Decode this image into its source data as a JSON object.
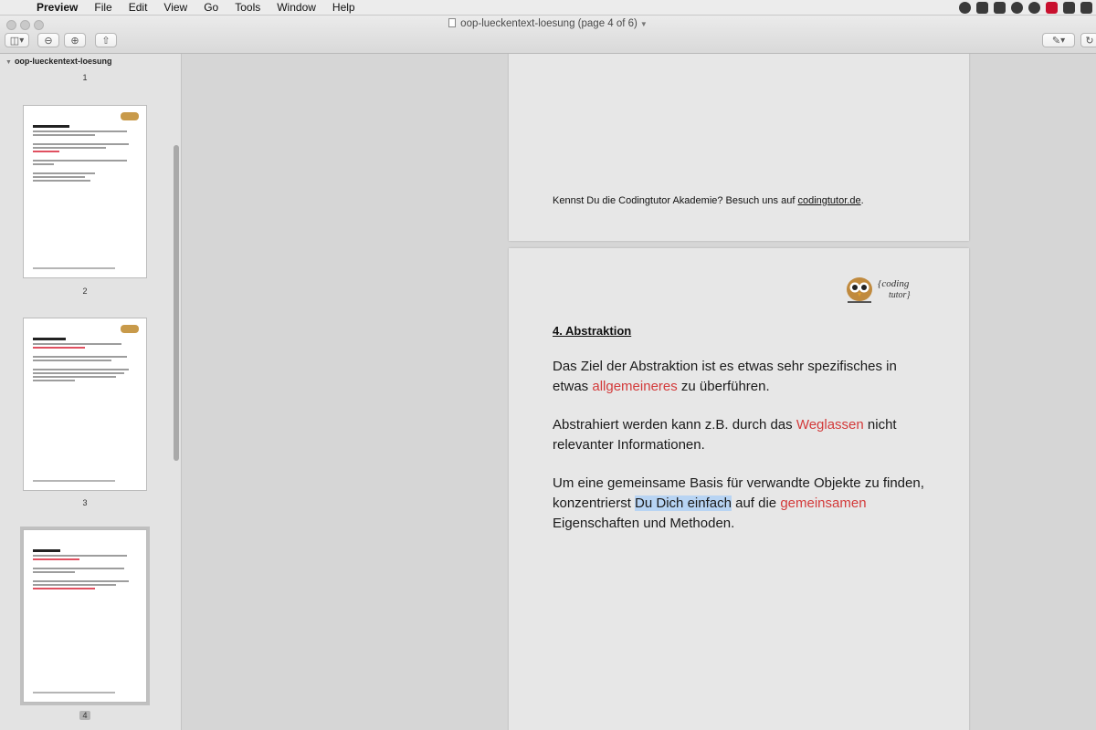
{
  "menubar": {
    "app_name": "Preview",
    "menus": [
      "File",
      "Edit",
      "View",
      "Go",
      "Tools",
      "Window",
      "Help"
    ]
  },
  "window": {
    "title": "oop-lueckentext-loesung (page 4 of 6)"
  },
  "sidebar": {
    "document_name": "oop-lueckentext-loesung",
    "pages": [
      {
        "number": "1"
      },
      {
        "number": "2"
      },
      {
        "number": "3"
      },
      {
        "number": "4"
      }
    ],
    "selected_page": "4"
  },
  "page3": {
    "footer_prefix": "Kennst Du die Codingtutor Akademie? Besuch uns auf ",
    "footer_link": "codingtutor.de",
    "footer_suffix": "."
  },
  "page4": {
    "logo_text": "{coding tutor}",
    "heading": "4. Abstraktion",
    "p1_a": "Das Ziel der Abstraktion ist es etwas sehr spezifisches in etwas ",
    "p1_hl": "allgemeineres",
    "p1_b": " zu überführen.",
    "p2_a": "Abstrahiert werden kann z.B. durch das ",
    "p2_hl": "Weglassen",
    "p2_b": " nicht relevanter Informationen.",
    "p3_a": "Um eine gemeinsame Basis für verwandte Objekte zu finden, konzentrierst ",
    "p3_sel": "Du Dich einfach",
    "p3_b": " auf die ",
    "p3_hl": "gemeinsamen",
    "p3_c": " Eigenschaften und Methoden."
  },
  "colors": {
    "highlight_red": "#d33a3a",
    "selection_blue": "#b8d4f3"
  }
}
